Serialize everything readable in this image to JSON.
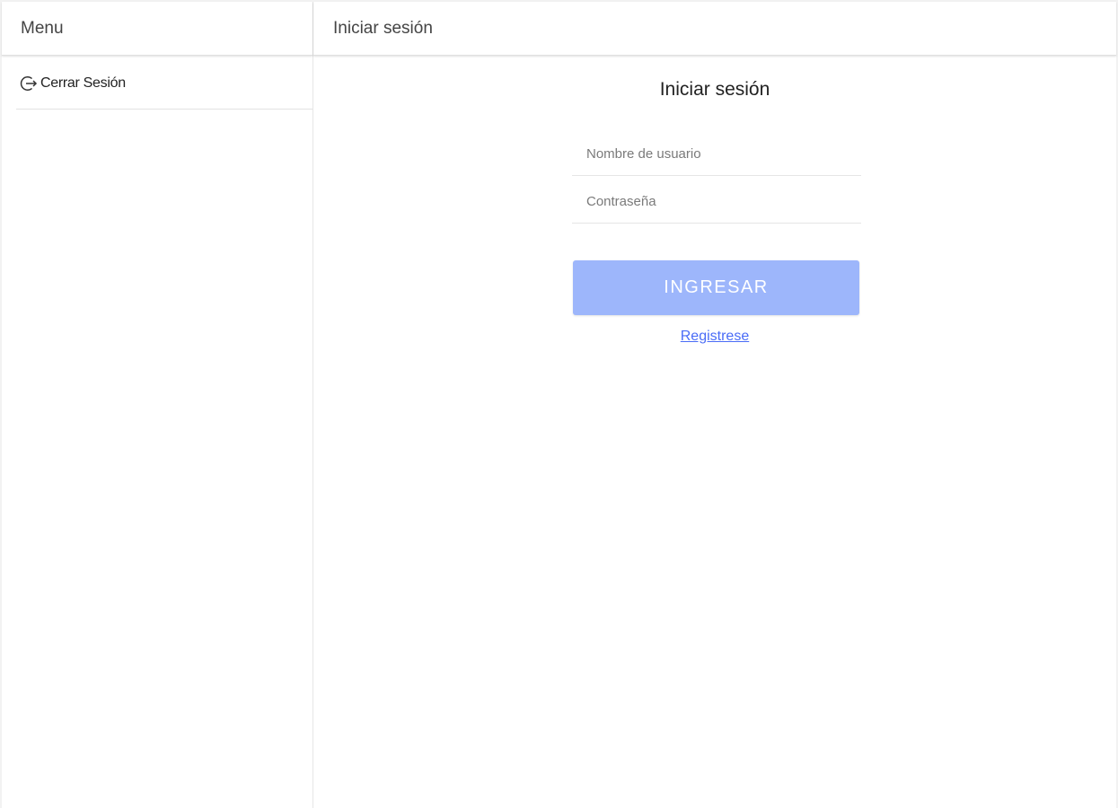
{
  "sidebar": {
    "title": "Menu",
    "items": [
      {
        "label": "Cerrar Sesión",
        "icon": "logout-icon"
      }
    ]
  },
  "main": {
    "header_title": "Iniciar sesión",
    "form": {
      "title": "Iniciar sesión",
      "username": {
        "placeholder": "Nombre de usuario",
        "value": ""
      },
      "password": {
        "placeholder": "Contraseña",
        "value": ""
      },
      "submit_label": "INGRESAR",
      "register_link": "Registrese"
    }
  },
  "colors": {
    "button_bg": "#9db6fb",
    "link": "#4a6cf7",
    "header_text": "#444444"
  }
}
